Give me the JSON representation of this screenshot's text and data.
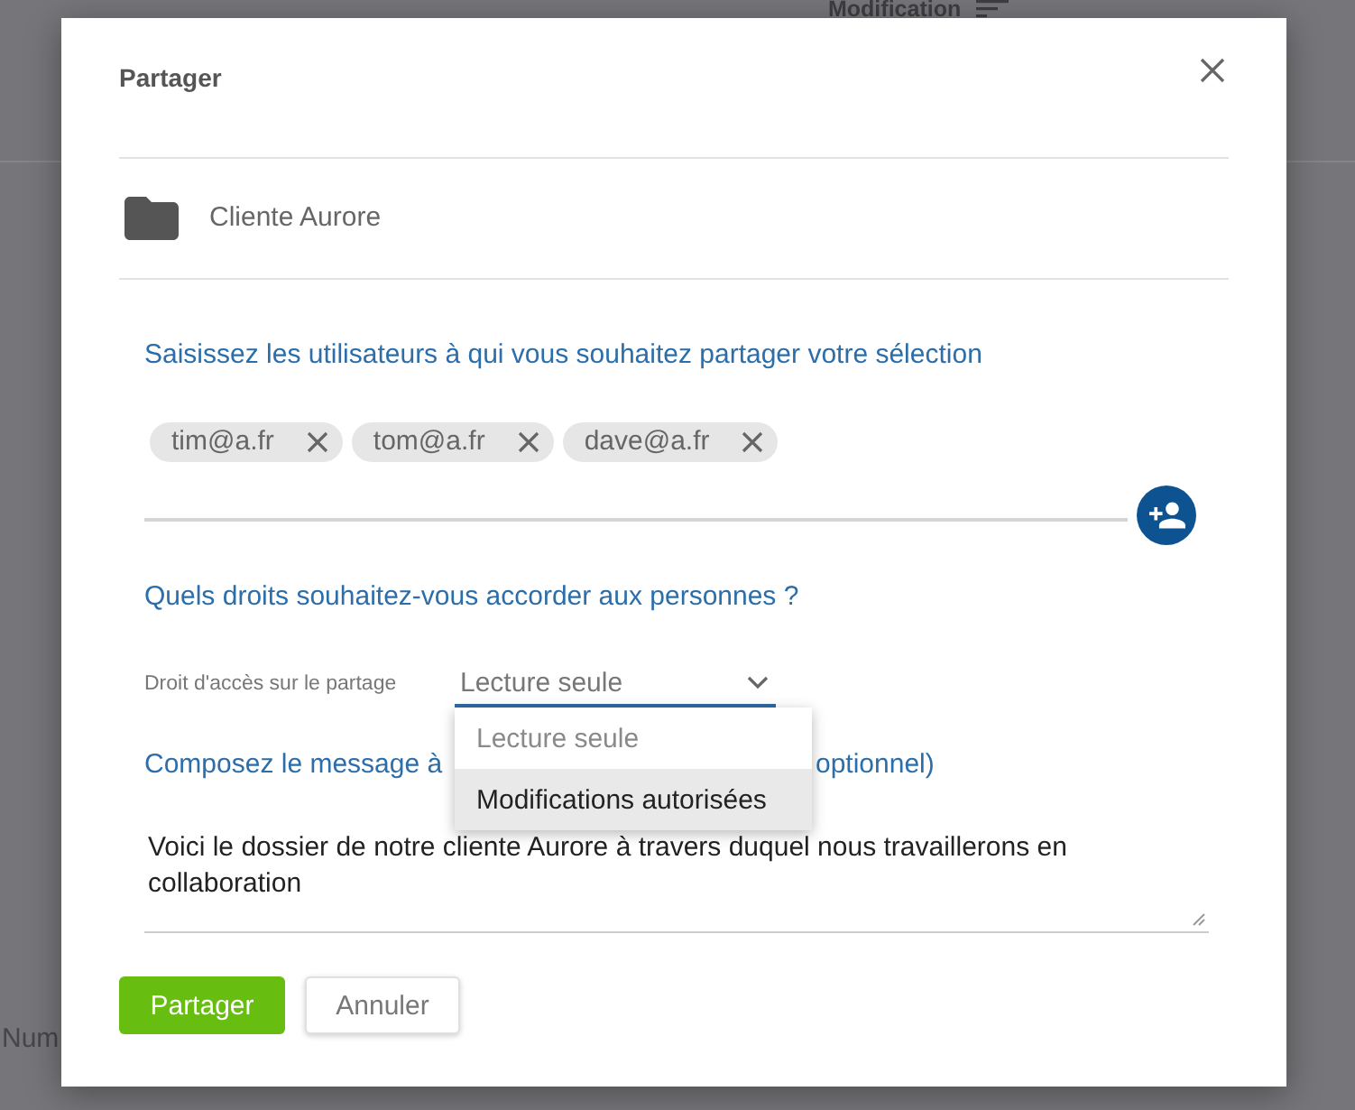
{
  "background": {
    "column_header": "Modification",
    "row_label": "Num"
  },
  "dialog": {
    "title": "Partager",
    "folder": {
      "name": "Cliente Aurore"
    },
    "recipients": {
      "heading": "Saisissez les utilisateurs à qui vous souhaitez partager votre sélection",
      "chips": [
        {
          "label": "tim@a.fr"
        },
        {
          "label": "tom@a.fr"
        },
        {
          "label": "dave@a.fr"
        }
      ]
    },
    "rights": {
      "heading": "Quels droits souhaitez-vous accorder aux personnes ?",
      "field_label": "Droit d'accès sur le partage",
      "value": "Lecture seule",
      "expanded": true,
      "options": [
        {
          "label": "Lecture seule",
          "selected": true,
          "highlighted": false
        },
        {
          "label": "Modifications autorisées",
          "selected": false,
          "highlighted": true
        }
      ]
    },
    "message": {
      "heading_parts": [
        "Composez le message à",
        "optionnel)"
      ],
      "value": "Voici le dossier de notre cliente Aurore à travers duquel nous travaillerons en collaboration"
    },
    "buttons": [
      {
        "label": "Partager",
        "kind": "primary"
      },
      {
        "label": "Annuler",
        "kind": "secondary"
      }
    ]
  }
}
